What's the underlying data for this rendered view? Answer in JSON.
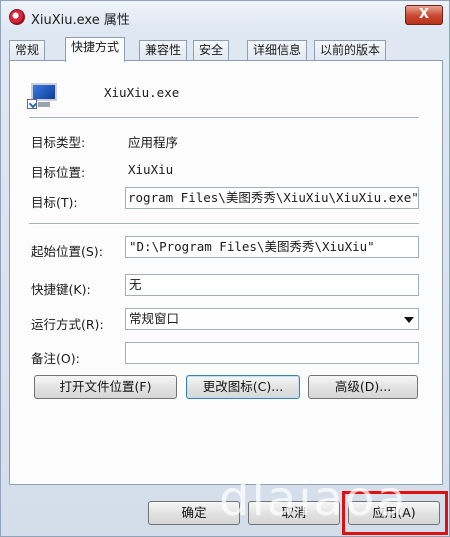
{
  "window": {
    "title": "XiuXiu.exe 属性",
    "close_glyph": "X"
  },
  "tabs": [
    {
      "label": "常规",
      "active": false
    },
    {
      "label": "快捷方式",
      "active": true
    },
    {
      "label": "兼容性",
      "active": false
    },
    {
      "label": "安全",
      "active": false
    },
    {
      "label": "详细信息",
      "active": false
    },
    {
      "label": "以前的版本",
      "active": false
    }
  ],
  "shortcut": {
    "file_name": "XiuXiu.exe",
    "target_type_label": "目标类型:",
    "target_type_value": "应用程序",
    "target_location_label": "目标位置:",
    "target_location_value": "XiuXiu",
    "target_label": "目标(T):",
    "target_value": "rogram Files\\美图秀秀\\XiuXiu\\XiuXiu.exe\"",
    "start_in_label": "起始位置(S):",
    "start_in_value": "\"D:\\Program Files\\美图秀秀\\XiuXiu\"",
    "shortcut_key_label": "快捷键(K):",
    "shortcut_key_value": "无",
    "run_label": "运行方式(R):",
    "run_value": "常规窗口",
    "comment_label": "备注(O):",
    "comment_value": ""
  },
  "buttons": {
    "open_location": "打开文件位置(F)",
    "change_icon": "更改图标(C)...",
    "advanced": "高级(D)..."
  },
  "footer": {
    "ok": "确定",
    "cancel": "取消",
    "apply": "应用(A)"
  },
  "watermark": "dlaiaoa",
  "colors": {
    "highlight_outline": "#e01010",
    "close_button": "#c9472f"
  }
}
